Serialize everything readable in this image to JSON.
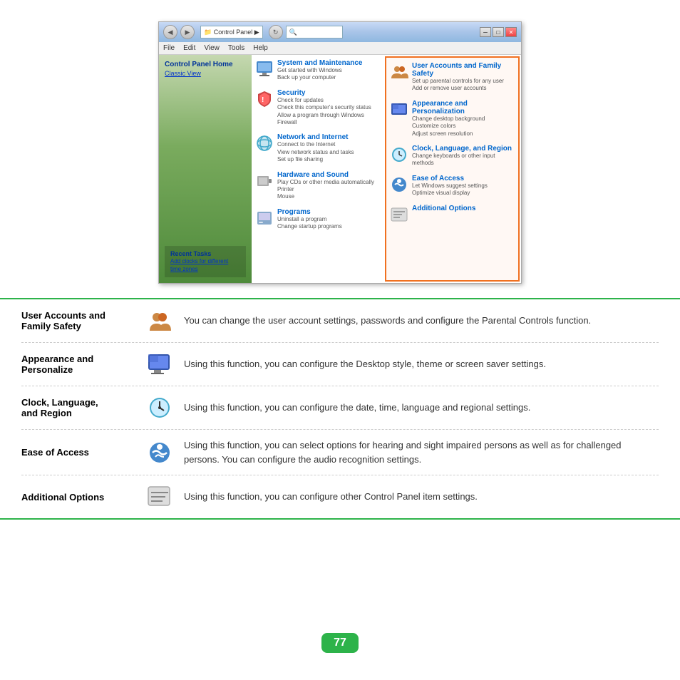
{
  "page": {
    "number": "77"
  },
  "screenshot": {
    "titlebar": {
      "address": "Control Panel",
      "search_placeholder": "🔍",
      "nav_back": "◀",
      "nav_forward": "▶",
      "btn_min": "─",
      "btn_max": "□",
      "btn_close": "✕"
    },
    "menubar": {
      "items": [
        "File",
        "Edit",
        "View",
        "Tools",
        "Help"
      ]
    },
    "sidebar": {
      "title": "Control Panel Home",
      "link": "Classic View",
      "recent_title": "Recent Tasks",
      "recent_link": "Add clocks for different time zones"
    },
    "left_column": [
      {
        "title": "System and Maintenance",
        "desc": "Get started with Windows\nBack up your computer"
      },
      {
        "title": "Security",
        "desc": "Check for updates\nCheck this computer's security status\nAllow a program through Windows Firewall"
      },
      {
        "title": "Network and Internet",
        "desc": "Connect to the Internet\nView network status and tasks\nSet up file sharing"
      },
      {
        "title": "Hardware and Sound",
        "desc": "Play CDs or other media automatically\nPrinter\nMouse"
      },
      {
        "title": "Programs",
        "desc": "Uninstall a program\nChange startup programs"
      }
    ],
    "right_column": [
      {
        "title": "User Accounts and Family Safety",
        "desc": "Set up parental controls for any user\nAdd or remove user accounts",
        "highlighted": true
      },
      {
        "title": "Appearance and Personalization",
        "desc": "Change desktop background\nCustomize colors\nAdjust screen resolution",
        "highlighted": true
      },
      {
        "title": "Clock, Language, and Region",
        "desc": "Change keyboards or other input methods",
        "highlighted": true
      },
      {
        "title": "Ease of Access",
        "desc": "Let Windows suggest settings\nOptimize visual display",
        "highlighted": true
      },
      {
        "title": "Additional Options",
        "desc": "",
        "highlighted": true
      }
    ]
  },
  "table": {
    "rows": [
      {
        "label": "User Accounts and\nFamily Safety",
        "description": "You can change the user account settings, passwords and configure the Parental Controls function."
      },
      {
        "label": "Appearance and\nPersonalize",
        "description": "Using this function, you can configure the Desktop style, theme or screen saver settings."
      },
      {
        "label": "Clock, Language,\nand Region",
        "description": "Using this function, you can configure the date, time, language and regional settings."
      },
      {
        "label": "Ease of Access",
        "description": "Using this function, you can select options for hearing and sight impaired persons as well as for challenged persons. You can configure the audio recognition settings."
      },
      {
        "label": "Additional Options",
        "description": "Using this function, you can configure other Control Panel item settings."
      }
    ]
  }
}
